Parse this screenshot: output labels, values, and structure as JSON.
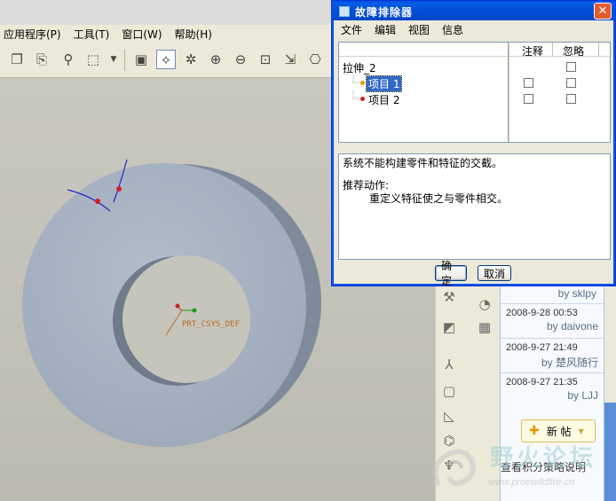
{
  "cad": {
    "menu": [
      "应用程序(P)",
      "工具(T)",
      "窗口(W)",
      "帮助(H)"
    ],
    "csys_label": "PRT_CSYS_DEF"
  },
  "dialog": {
    "title": "故障排除器",
    "menu": [
      "文件",
      "编辑",
      "视图",
      "信息"
    ],
    "columns": {
      "note": "注释",
      "ignore": "忽略"
    },
    "tree": {
      "root": "拉伸_2",
      "items": [
        {
          "label": "项目 1",
          "selected": true,
          "dot_color": "#e0a000"
        },
        {
          "label": "项目 2",
          "selected": false,
          "dot_color": "#d02020"
        }
      ]
    },
    "message": "系统不能构建零件和特征的交截。",
    "recommend_title": "推荐动作:",
    "recommend_body": "重定义特征使之与零件相交。",
    "ok_label": "确定",
    "cancel_label": "取消"
  },
  "forum": {
    "first_author": "by sklpy",
    "entries": [
      {
        "date": "2008-9-28 00:53",
        "author": "by daivone"
      },
      {
        "date": "2008-9-27 21:49",
        "author": "by 楚风随行"
      },
      {
        "date": "2008-9-27 21:35",
        "author": "by LJJ"
      }
    ],
    "new_post_label": "新 帖",
    "score_link": "查看积分策略说明"
  },
  "watermark": {
    "text": "野火论坛",
    "url": "www.proewildfire.cn"
  },
  "colors": {
    "titlebar": "#0054e3",
    "part": "#a8b4c3",
    "selection": "#316ac5",
    "close": "#e35b2d"
  }
}
